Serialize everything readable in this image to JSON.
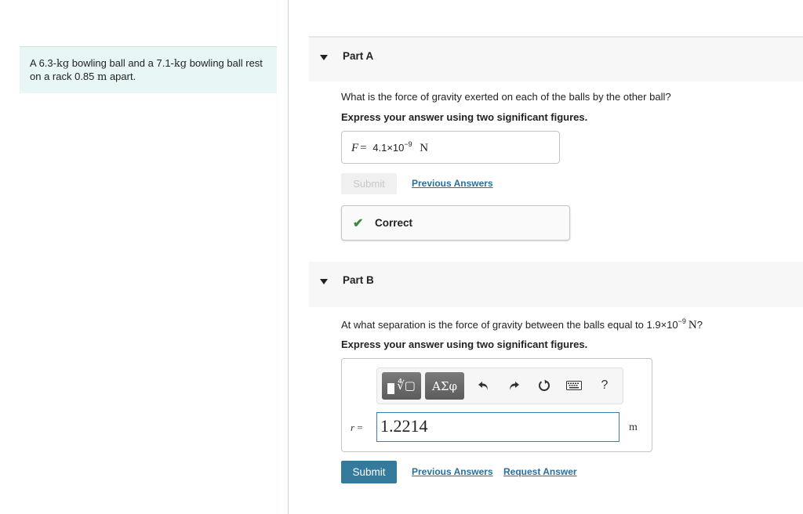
{
  "problem": {
    "text_parts": [
      {
        "t": "A 6.3-",
        "math": false
      },
      {
        "t": "kg",
        "math": true
      },
      {
        "t": " bowling ball and a 7.1-",
        "math": false
      },
      {
        "t": "kg",
        "math": true
      },
      {
        "t": " bowling ball rest on a rack 0.85 ",
        "math": false
      },
      {
        "t": "m",
        "math": true
      },
      {
        "t": " apart.",
        "math": false
      }
    ]
  },
  "partA": {
    "label": "Part A",
    "question": "What is the force of gravity exerted on each of the balls by the other ball?",
    "instruction": "Express your answer using two significant figures.",
    "answer": {
      "variable": "F",
      "equals": "=",
      "mantissa": "4.1×10",
      "exponent": "−9",
      "unit": "N"
    },
    "submit_label": "Submit",
    "previous_answers_label": "Previous Answers",
    "feedback": {
      "icon": "check-icon",
      "text": "Correct",
      "color": "#3c8a3c"
    }
  },
  "partB": {
    "label": "Part B",
    "question_prefix": "At what separation is the force of gravity between the balls equal to 1.9×10",
    "question_exponent": "−9",
    "question_unit": "N",
    "question_suffix": "?",
    "instruction": "Express your answer using two significant figures.",
    "toolbar": {
      "templates_icon": "templates-radical-icon",
      "greek_label": "ΑΣφ",
      "undo_icon": "undo-icon",
      "redo_icon": "redo-icon",
      "reset_icon": "reset-icon",
      "keyboard_icon": "keyboard-icon",
      "help_label": "?"
    },
    "input": {
      "variable": "r",
      "equals": "=",
      "value": "1.2214",
      "unit": "m"
    },
    "submit_label": "Submit",
    "previous_answers_label": "Previous Answers",
    "request_answer_label": "Request Answer"
  },
  "colors": {
    "accent": "#337a9c",
    "link": "#2d6d98",
    "problem_bg": "#e9f6f6",
    "correct": "#3c8a3c"
  }
}
